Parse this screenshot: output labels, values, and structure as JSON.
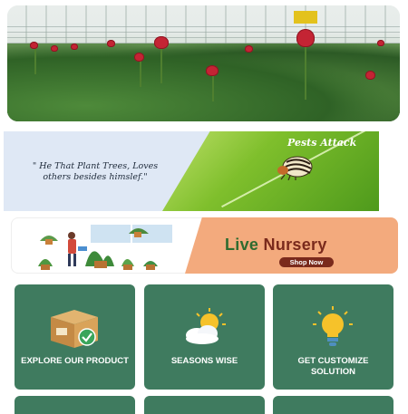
{
  "pests_banner": {
    "title": "Pests Attack",
    "quote": "\" He That Plant Trees, Loves others besides himslef.\""
  },
  "nursery_banner": {
    "title_part1": "Live",
    "title_part2": "Nursery",
    "button_label": "Shop Now"
  },
  "categories": [
    {
      "label": "EXPLORE OUR PRODUCT",
      "icon": "box-icon"
    },
    {
      "label": "SEASONS WISE",
      "icon": "weather-icon"
    },
    {
      "label": "GET CUSTOMIZE SOLUTION",
      "icon": "bulb-icon"
    }
  ],
  "colors": {
    "card_bg": "#3f7b5f",
    "nursery_accent": "#f3aa7d",
    "nursery_green": "#2e6b2f",
    "nursery_brown": "#7a2a1c"
  }
}
